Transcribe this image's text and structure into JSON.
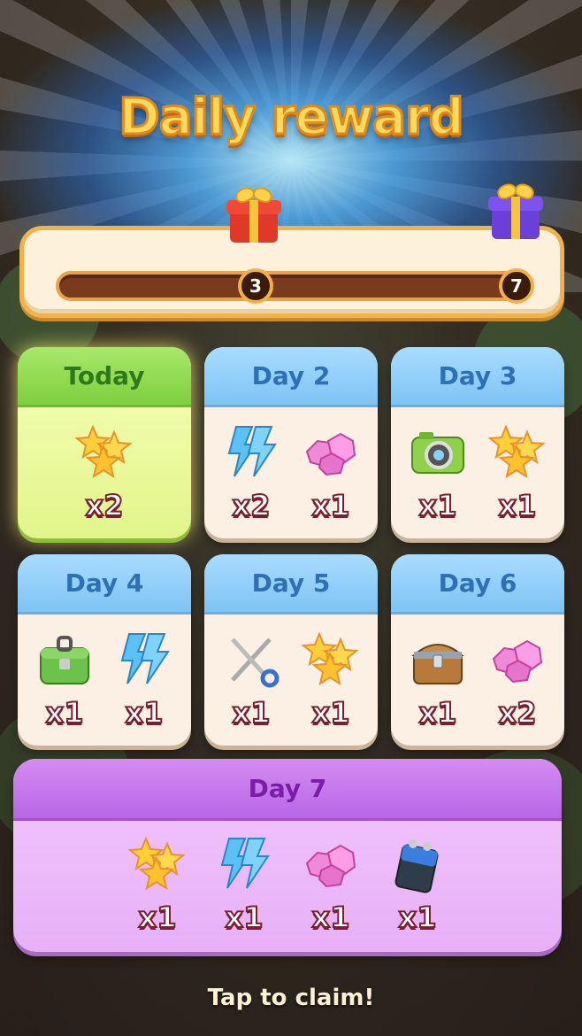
{
  "title": "Daily reward",
  "progress": {
    "current": "3",
    "goal": "7",
    "fraction": 0.4
  },
  "cards": [
    {
      "label": "Today",
      "items": [
        {
          "icon": "star-icon",
          "qty": "x2"
        }
      ]
    },
    {
      "label": "Day 2",
      "items": [
        {
          "icon": "lightning-icon",
          "qty": "x2"
        },
        {
          "icon": "gem-icon",
          "qty": "x1"
        }
      ]
    },
    {
      "label": "Day 3",
      "items": [
        {
          "icon": "camera-icon",
          "qty": "x1"
        },
        {
          "icon": "star-icon",
          "qty": "x1"
        }
      ]
    },
    {
      "label": "Day 4",
      "items": [
        {
          "icon": "chest-green-icon",
          "qty": "x1"
        },
        {
          "icon": "lightning-icon",
          "qty": "x1"
        }
      ]
    },
    {
      "label": "Day 5",
      "items": [
        {
          "icon": "scissors-icon",
          "qty": "x1"
        },
        {
          "icon": "star-icon",
          "qty": "x1"
        }
      ]
    },
    {
      "label": "Day 6",
      "items": [
        {
          "icon": "treasure-chest-icon",
          "qty": "x1"
        },
        {
          "icon": "gem-icon",
          "qty": "x2"
        }
      ]
    }
  ],
  "day7": {
    "label": "Day 7",
    "items": [
      {
        "icon": "star-icon",
        "qty": "x1"
      },
      {
        "icon": "lightning-icon",
        "qty": "x1"
      },
      {
        "icon": "gem-icon",
        "qty": "x1"
      },
      {
        "icon": "battery-icon",
        "qty": "x1"
      }
    ]
  },
  "footer": "Tap to claim!",
  "colors": {
    "accent": "#f0b24a",
    "today": "#7fcf3e",
    "day": "#7ec3f5",
    "day7": "#b866e6"
  }
}
